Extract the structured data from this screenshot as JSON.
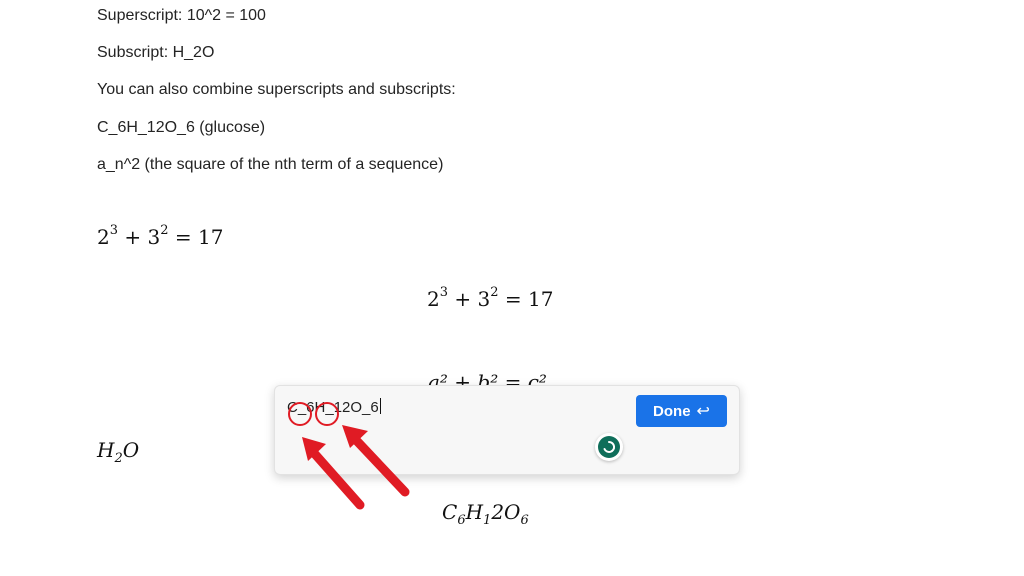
{
  "document": {
    "lines": [
      "Superscript: 10^2 = 100",
      "Subscript: H_2O",
      "You can also combine superscripts and subscripts:",
      "C_6H_12O_6 (glucose)",
      "a_n^2 (the square of the nth term of a sequence)"
    ],
    "eq_inline": {
      "a": "2",
      "a_exp": "3",
      "plus": "+",
      "b": "3",
      "b_exp": "2",
      "equals": "=",
      "result": "17"
    },
    "eq_display": {
      "a": "2",
      "a_exp": "3",
      "plus": "+",
      "b": "3",
      "b_exp": "2",
      "equals": "=",
      "result": "17"
    },
    "eq_partial": "a² + b² = c²",
    "water": {
      "h": "H",
      "sub": "2",
      "o": "O"
    },
    "glucose": {
      "c": "C",
      "c_sub": "6",
      "h": "H",
      "h_sub": "1",
      "rest": "2O",
      "o_sub": "6"
    }
  },
  "editor": {
    "value": "C_6H_12O_6",
    "done_label": "Done",
    "done_icon": "↩",
    "spinner_icon": "loading-icon"
  },
  "colors": {
    "accent": "#1a73e8",
    "annotation": "#e01b24",
    "spinner": "#0f6e5a"
  }
}
